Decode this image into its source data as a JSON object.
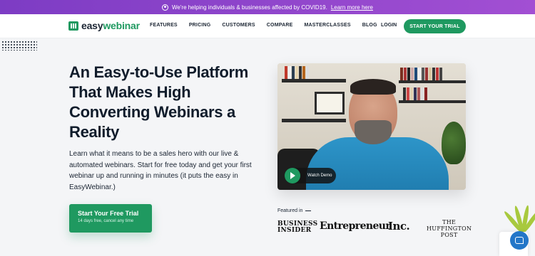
{
  "banner": {
    "message": "We're helping individuals & businesses affected by COVID19.",
    "link": "Learn more here",
    "icon": "virus-icon"
  },
  "nav": {
    "logo_easy": "easy",
    "logo_webinar": "webinar",
    "items": [
      "FEATURES",
      "PRICING",
      "CUSTOMERS",
      "COMPARE",
      "MASTERCLASSES",
      "BLOG"
    ],
    "login": "LOGIN",
    "trial_button": "START YOUR TRIAL"
  },
  "hero": {
    "headline": "An Easy-to-Use Platform That Makes High Converting Webinars a Reality",
    "subtext": "Learn what it means to be a sales hero with our live & automated webinars. Start for free today and get your first webinar up and running in minutes (it puts the easy in EasyWebinar.)",
    "cta_title": "Start Your Free Trial",
    "cta_subtitle": "14 days free, cancel any time"
  },
  "video": {
    "watch_label": "Watch Demo",
    "play_icon": "play-icon"
  },
  "press": {
    "featured_label": "Featured in",
    "logos": [
      "BUSINESS INSIDER",
      "Entrepreneur",
      "Inc.",
      "THE HUFFINGTON POST"
    ]
  },
  "colors": {
    "brand_green": "#1f9960",
    "banner_purple": "#8a43c9",
    "chat_blue": "#2376c8"
  }
}
